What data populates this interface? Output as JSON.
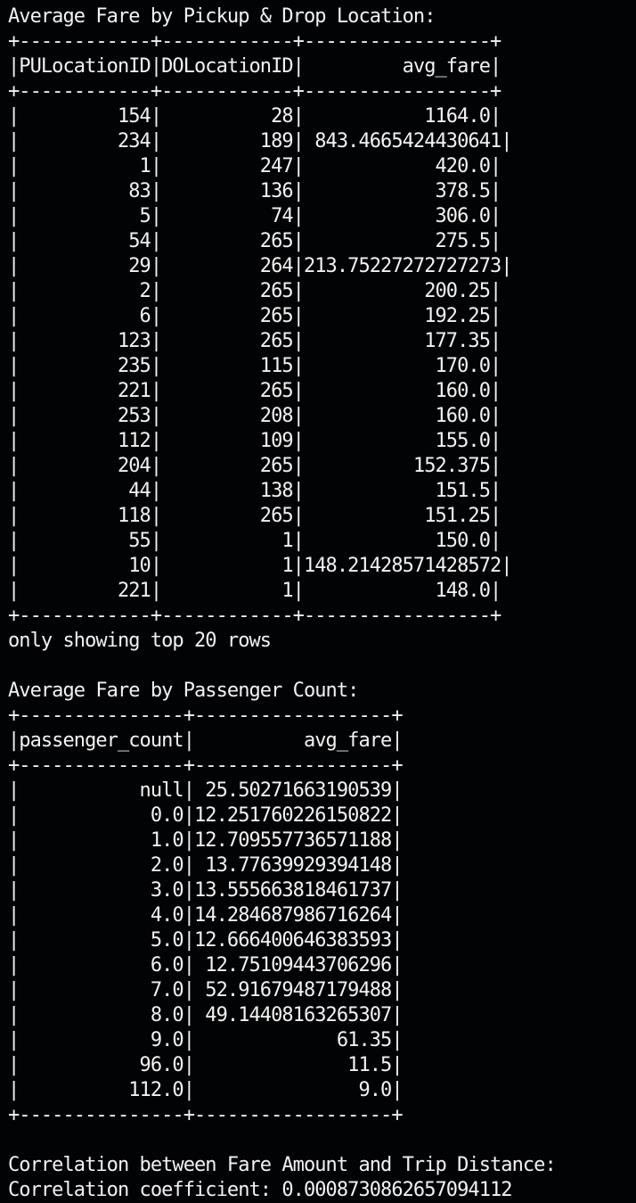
{
  "terminal": {
    "lines": [
      "Average Fare by Pickup & Drop Location:",
      "+------------+------------+-----------------+",
      "|PULocationID|DOLocationID|         avg_fare|",
      "+------------+------------+-----------------+",
      "|         154|          28|           1164.0|",
      "|         234|         189| 843.4665424430641|",
      "|           1|         247|            420.0|",
      "|          83|         136|            378.5|",
      "|           5|          74|            306.0|",
      "|          54|         265|            275.5|",
      "|          29|         264|213.75227272727273|",
      "|           2|         265|           200.25|",
      "|           6|         265|           192.25|",
      "|         123|         265|           177.35|",
      "|         235|         115|            170.0|",
      "|         221|         265|            160.0|",
      "|         253|         208|            160.0|",
      "|         112|         109|            155.0|",
      "|         204|         265|          152.375|",
      "|          44|         138|            151.5|",
      "|         118|         265|           151.25|",
      "|          55|           1|            150.0|",
      "|          10|           1|148.21428571428572|",
      "|         221|           1|            148.0|",
      "+------------+------------+-----------------+",
      "only showing top 20 rows",
      "",
      "Average Fare by Passenger Count:",
      "+---------------+------------------+",
      "|passenger_count|          avg_fare|",
      "+---------------+------------------+",
      "|           null| 25.50271663190539|",
      "|            0.0|12.251760226150822|",
      "|            1.0|12.709557736571188|",
      "|            2.0| 13.77639929394148|",
      "|            3.0|13.555663818461737|",
      "|            4.0|14.284687986716264|",
      "|            5.0|12.666400646383593|",
      "|            6.0| 12.75109443706296|",
      "|            7.0| 52.91679487179488|",
      "|            8.0| 49.14408163265307|",
      "|            9.0|             61.35|",
      "|           96.0|              11.5|",
      "|          112.0|               9.0|",
      "+---------------+------------------+",
      "",
      "Correlation between Fare Amount and Trip Distance:",
      "Correlation coefficient: 0.0008730862657094112"
    ]
  },
  "colors": {
    "background": "#020305",
    "text": "#f2f2f2"
  }
}
